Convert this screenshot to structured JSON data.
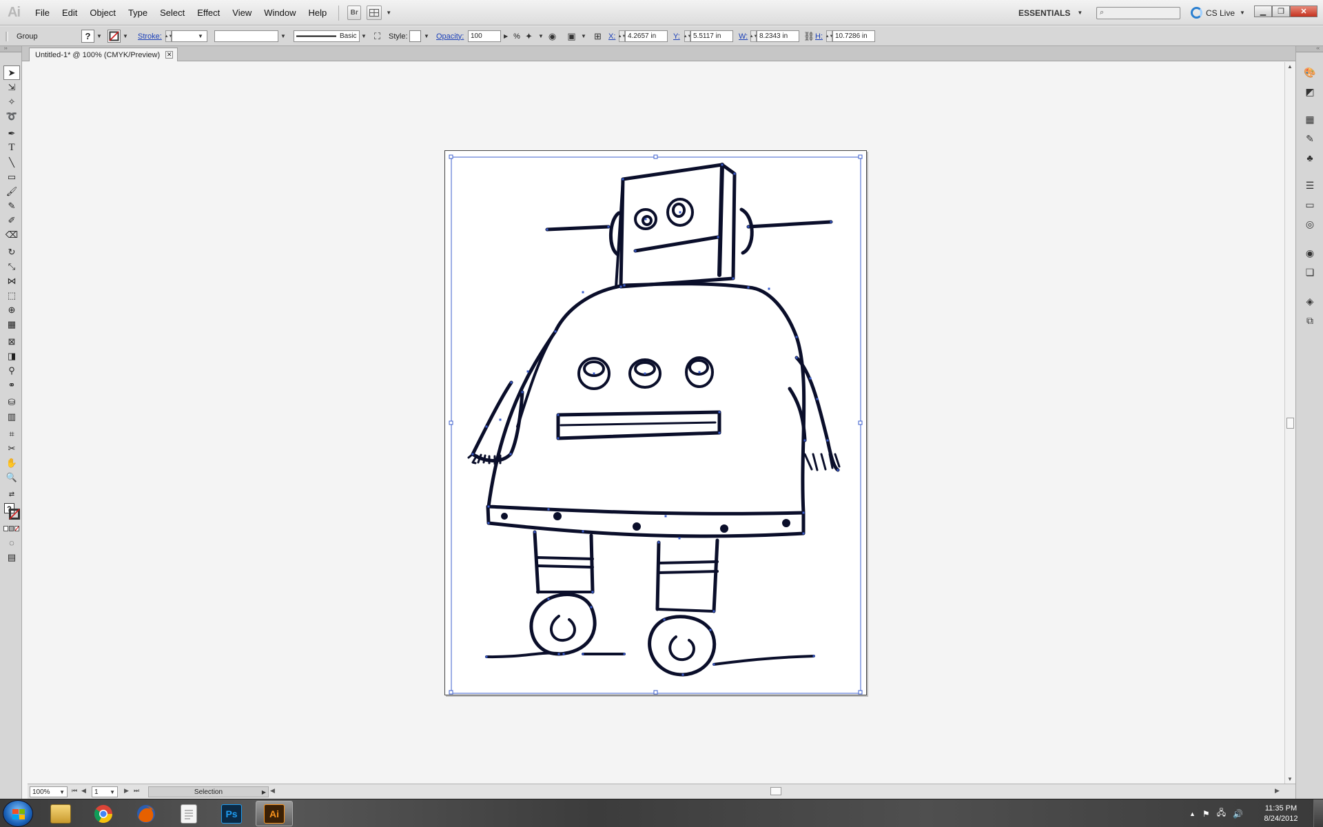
{
  "app": {
    "logo": "Ai",
    "menus": [
      "File",
      "Edit",
      "Object",
      "Type",
      "Select",
      "Effect",
      "View",
      "Window",
      "Help"
    ],
    "bridge_label": "Br",
    "workspace": "ESSENTIALS",
    "search_placeholder": "",
    "cslive_label": "CS Live"
  },
  "control_bar": {
    "selection_type": "Group",
    "stroke_label": "Stroke:",
    "stroke_value": "",
    "brush_label": "Basic",
    "style_label": "Style:",
    "opacity_label": "Opacity:",
    "opacity_value": "100",
    "opacity_unit": "%",
    "x_label": "X:",
    "x_value": "4.2657 in",
    "y_label": "Y:",
    "y_value": "5.5117 in",
    "w_label": "W:",
    "w_value": "8.2343 in",
    "h_label": "H:",
    "h_value": "10.7286 in"
  },
  "document": {
    "tab_title": "Untitled-1* @ 100% (CMYK/Preview)"
  },
  "status_bar": {
    "zoom": "100%",
    "page": "1",
    "mode": "Selection"
  },
  "tools": [
    "selection-tool",
    "direct-selection-tool",
    "magic-wand-tool",
    "lasso-tool",
    "pen-tool",
    "type-tool",
    "line-segment-tool",
    "rectangle-tool",
    "paintbrush-tool",
    "pencil-tool",
    "blob-brush-tool",
    "eraser-tool",
    "rotate-tool",
    "scale-tool",
    "width-tool",
    "free-transform-tool",
    "shape-builder-tool",
    "perspective-grid-tool",
    "mesh-tool",
    "gradient-tool",
    "eyedropper-tool",
    "blend-tool",
    "symbol-sprayer-tool",
    "column-graph-tool",
    "artboard-tool",
    "slice-tool",
    "hand-tool",
    "zoom-tool"
  ],
  "right_panels": [
    "color-panel-icon",
    "color-guide-panel-icon",
    "swatches-panel-icon",
    "brushes-panel-icon",
    "symbols-panel-icon",
    "stroke-panel-icon",
    "gradient-panel-icon",
    "transparency-panel-icon",
    "appearance-panel-icon",
    "graphic-styles-panel-icon",
    "layers-panel-icon",
    "artboards-panel-icon"
  ],
  "taskbar": {
    "apps": [
      "windows-explorer",
      "google-chrome",
      "firefox",
      "document-viewer",
      "photoshop",
      "illustrator"
    ],
    "photoshop_label": "Ps",
    "illustrator_label": "Ai",
    "time": "11:35 PM",
    "date": "8/24/2012"
  },
  "colors": {
    "selection_blue": "#3a5ccc",
    "artwork_ink": "#0a0e2a",
    "illustrator_orange": "#f7931e",
    "photoshop_blue": "#1e9cf0"
  }
}
